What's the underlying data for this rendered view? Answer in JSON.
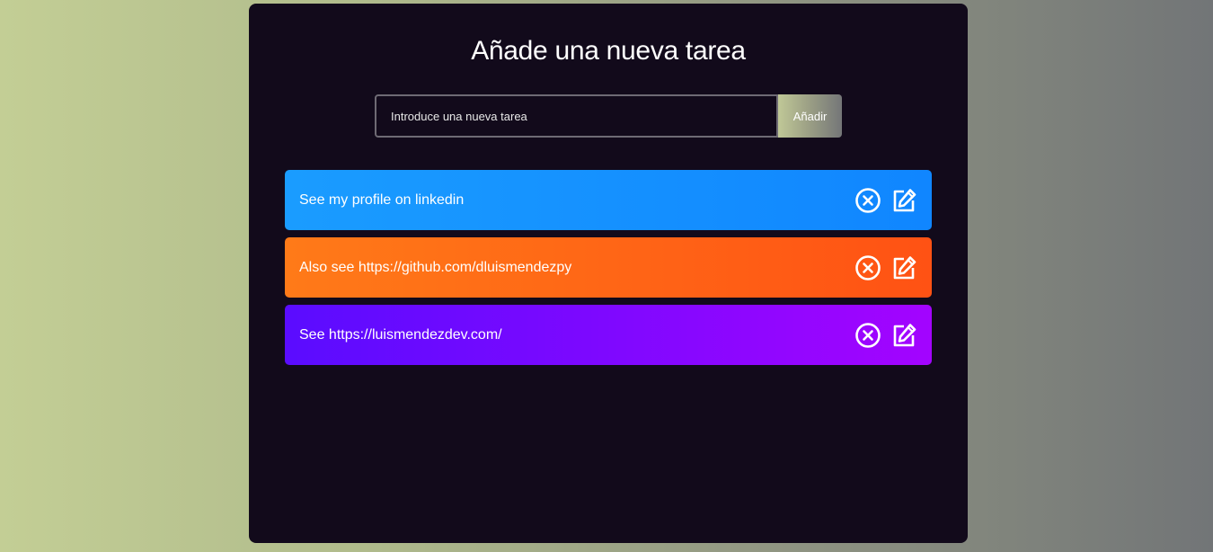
{
  "header": {
    "title": "Añade una nueva tarea"
  },
  "form": {
    "input_placeholder": "Introduce una nueva tarea",
    "input_value": "",
    "add_label": "Añadir"
  },
  "todos": [
    {
      "text": "See my profile on linkedin",
      "color": "#1a9cff",
      "delete_icon": "close-circle-icon",
      "edit_icon": "edit-icon"
    },
    {
      "text": "Also see https://github.com/dluismendezpy",
      "color": "#ff7a18",
      "delete_icon": "close-circle-icon",
      "edit_icon": "edit-icon"
    },
    {
      "text": "See https://luismendezdev.com/",
      "color": "#5a0cff",
      "delete_icon": "close-circle-icon",
      "edit_icon": "edit-icon"
    }
  ],
  "colors": {
    "app_background": "#120a1b",
    "page_gradient_start": "#c3ce95",
    "page_gradient_end": "#727577"
  }
}
